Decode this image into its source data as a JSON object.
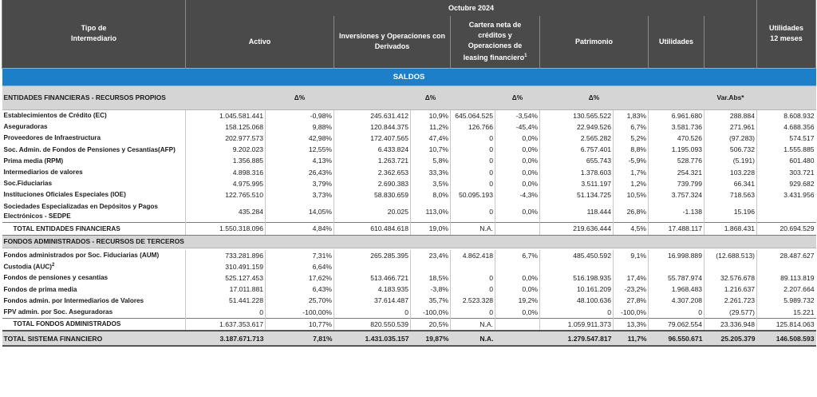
{
  "header": {
    "period": "Octubre  2024",
    "tipo": [
      "Tipo de",
      "Intermediario"
    ],
    "activo": "Activo",
    "inversiones": [
      "Inversiones y Operaciones con",
      "Derivados"
    ],
    "cartera": [
      "Cartera neta de",
      "créditos y",
      "Operaciones de",
      "leasing financiero"
    ],
    "cartera_sup": "1",
    "patrimonio": "Patrimonio",
    "utilidades": "Utilidades",
    "utilidades12": [
      "Utilidades",
      "12 meses"
    ]
  },
  "saldos_label": "SALDOS",
  "section1": {
    "title": "ENTIDADES FINANCIERAS - RECURSOS PROPIOS",
    "delta": "Δ%",
    "varabs": "Var.Abs*"
  },
  "rows1": [
    {
      "name": "Establecimientos de Crédito (EC)",
      "activo": "1.045.581.441",
      "d1": "-0,98%",
      "inv": "245.631.412",
      "d2": "10,9%",
      "cart": "645.064.525",
      "d3": "-3,54%",
      "pat": "130.565.522",
      "d4": "1,83%",
      "util": "6.961.680",
      "var": "288.884",
      "u12": "8.608.932"
    },
    {
      "name": "Aseguradoras",
      "activo": "158.125.068",
      "d1": "9,88%",
      "inv": "120.844.375",
      "d2": "11,2%",
      "cart": "126.766",
      "d3": "-45,4%",
      "pat": "22.949.526",
      "d4": "6,7%",
      "util": "3.581.736",
      "var": "271.961",
      "u12": "4.688.356"
    },
    {
      "name": "Proveedores de Infraestructura",
      "activo": "202.977.573",
      "d1": "42,98%",
      "inv": "172.407.565",
      "d2": "47,4%",
      "cart": "0",
      "d3": "0,0%",
      "pat": "2.565.282",
      "d4": "5,2%",
      "util": "470.526",
      "var": "(97.283)",
      "u12": "574.517"
    },
    {
      "name": "Soc. Admin. de Fondos de Pensiones y Cesantías(AFP)",
      "activo": "9.202.023",
      "d1": "12,55%",
      "inv": "6.433.824",
      "d2": "10,7%",
      "cart": "0",
      "d3": "0,0%",
      "pat": "6.757.401",
      "d4": "8,8%",
      "util": "1.195.093",
      "var": "506.732",
      "u12": "1.555.885"
    },
    {
      "name": "Prima media (RPM)",
      "activo": "1.356.885",
      "d1": "4,13%",
      "inv": "1.263.721",
      "d2": "5,8%",
      "cart": "0",
      "d3": "0,0%",
      "pat": "655.743",
      "d4": "-5,9%",
      "util": "528.776",
      "var": "(5.191)",
      "u12": "601.480"
    },
    {
      "name": "Intermediarios de valores",
      "activo": "4.898.316",
      "d1": "26,43%",
      "inv": "2.362.653",
      "d2": "33,3%",
      "cart": "0",
      "d3": "0,0%",
      "pat": "1.378.603",
      "d4": "1,7%",
      "util": "254.321",
      "var": "103.228",
      "u12": "303.721"
    },
    {
      "name": "Soc.Fiduciarias",
      "activo": "4.975.995",
      "d1": "3,79%",
      "inv": "2.690.383",
      "d2": "3,5%",
      "cart": "0",
      "d3": "0,0%",
      "pat": "3.511.197",
      "d4": "1,2%",
      "util": "739.799",
      "var": "66.341",
      "u12": "929.682"
    },
    {
      "name": "Instituciones Oficiales Especiales (IOE)",
      "activo": "122.765.510",
      "d1": "3,73%",
      "inv": "58.830.659",
      "d2": "8,0%",
      "cart": "50.095.193",
      "d3": "-4,3%",
      "pat": "51.134.725",
      "d4": "10,5%",
      "util": "3.757.324",
      "var": "718.563",
      "u12": "3.431.956"
    }
  ],
  "sedpe": {
    "name": "Sociedades Especializadas en Depósitos y Pagos Electrónicos - SEDPE",
    "activo": "435.284",
    "d1": "14,05%",
    "inv": "20.025",
    "d2": "113,0%",
    "cart": "0",
    "d3": "0,0%",
    "pat": "118.444",
    "d4": "26,8%",
    "util": "-1.138",
    "var": "15.196",
    "u12": ""
  },
  "total1": {
    "name": "TOTAL ENTIDADES FINANCIERAS",
    "activo": "1.550.318.096",
    "d1": "4,84%",
    "inv": "610.484.618",
    "d2": "19,0%",
    "cart": "N.A.",
    "d3": "",
    "pat": "219.636.444",
    "d4": "4,5%",
    "util": "17.488.117",
    "var": "1.868.431",
    "u12": "20.694.529"
  },
  "section2": {
    "title": "FONDOS ADMINISTRADOS - RECURSOS DE TERCEROS"
  },
  "rows2": [
    {
      "name": "Fondos administrados por Soc. Fiduciarias (AUM)",
      "activo": "733.281.896",
      "d1": "7,31%",
      "inv": "265.285.395",
      "d2": "23,4%",
      "cart": "4.862.418",
      "d3": "6,7%",
      "pat": "485.450.592",
      "d4": "9,1%",
      "util": "16.998.889",
      "var": "(12.688.513)",
      "u12": "28.487.627"
    },
    {
      "name": "Custodia (AUC)",
      "sup": "2",
      "activo": "310.491.159",
      "d1": "6,64%",
      "inv": "",
      "d2": "",
      "cart": "",
      "d3": "",
      "pat": "",
      "d4": "",
      "util": "",
      "var": "",
      "u12": ""
    },
    {
      "name": "Fondos de pensiones y cesantías",
      "activo": "525.127.453",
      "d1": "17,62%",
      "inv": "513.466.721",
      "d2": "18,5%",
      "cart": "0",
      "d3": "0,0%",
      "pat": "516.198.935",
      "d4": "17,4%",
      "util": "55.787.974",
      "var": "32.576.678",
      "u12": "89.113.819"
    },
    {
      "name": "Fondos de prima media",
      "activo": "17.011.881",
      "d1": "6,43%",
      "inv": "4.183.935",
      "d2": "-3,8%",
      "cart": "0",
      "d3": "0,0%",
      "pat": "10.161.209",
      "d4": "-23,2%",
      "util": "1.968.483",
      "var": "1.216.637",
      "u12": "2.207.664"
    },
    {
      "name": "Fondos admin. por Intermediarios de Valores",
      "activo": "51.441.228",
      "d1": "25,70%",
      "inv": "37.614.487",
      "d2": "35,7%",
      "cart": "2.523.328",
      "d3": "19,2%",
      "pat": "48.100.636",
      "d4": "27,8%",
      "util": "4.307.208",
      "var": "2.261.723",
      "u12": "5.989.732"
    },
    {
      "name": "FPV admin. por Soc. Aseguradoras",
      "activo": "0",
      "d1": "-100,00%",
      "inv": "0",
      "d2": "-100,0%",
      "cart": "0",
      "d3": "0,0%",
      "pat": "0",
      "d4": "-100,0%",
      "util": "0",
      "var": "(29.577)",
      "u12": "15.221"
    }
  ],
  "total2": {
    "name": "TOTAL FONDOS ADMINISTRADOS",
    "activo": "1.637.353.617",
    "d1": "10,77%",
    "inv": "820.550.539",
    "d2": "20,5%",
    "cart": "N.A.",
    "d3": "",
    "pat": "1.059.911.373",
    "d4": "13,3%",
    "util": "79.062.554",
    "var": "23.336.948",
    "u12": "125.814.063"
  },
  "grand": {
    "name": "TOTAL SISTEMA FINANCIERO",
    "activo": "3.187.671.713",
    "d1": "7,81%",
    "inv": "1.431.035.157",
    "d2": "19,87%",
    "cart": "N.A.",
    "d3": "",
    "pat": "1.279.547.817",
    "d4": "11,7%",
    "util": "96.550.671",
    "var": "25.205.379",
    "u12": "146.508.593"
  }
}
